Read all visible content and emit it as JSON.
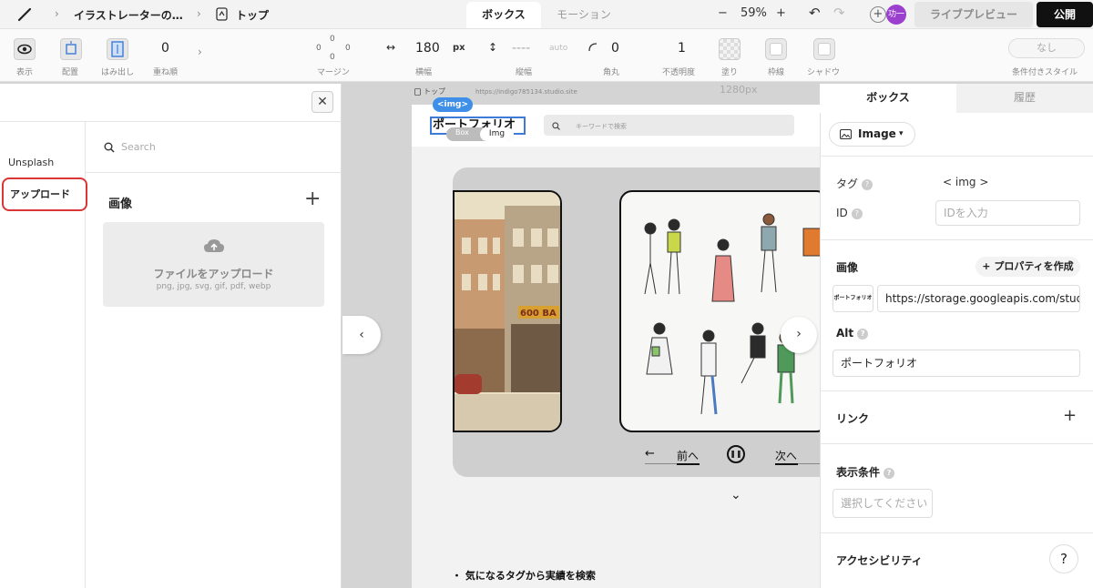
{
  "topbar": {
    "project_name": "イラストレーターの…",
    "page_name": "トップ",
    "tab_box": "ボックス",
    "tab_motion": "モーション",
    "zoom_minus": "−",
    "zoom_level": "59%",
    "zoom_plus": "+",
    "undo": "↶",
    "redo": "↷",
    "add_collaborator": "+",
    "avatar_text": "功一",
    "live_preview": "ライブプレビュー",
    "publish": "公開"
  },
  "toolbar": {
    "display_label": "表示",
    "layout_label": "配置",
    "overflow_label": "はみ出し",
    "zindex_label": "重ね順",
    "zindex_value": "0",
    "margin_label": "マージン",
    "margin_top": "0",
    "margin_left": "0",
    "margin_right": "0",
    "margin_bottom": "0",
    "width_label": "横幅",
    "width_value": "180",
    "width_unit": "px",
    "height_label": "縦幅",
    "height_value": "----",
    "height_unit": "auto",
    "radius_label": "角丸",
    "radius_value": "0",
    "opacity_label": "不透明度",
    "opacity_value": "1",
    "fill_label": "塗り",
    "border_label": "枠線",
    "shadow_label": "シャドウ",
    "conditional_style_label": "条件付きスタイル",
    "conditional_style_value": "なし"
  },
  "left_panel": {
    "source_unsplash": "Unsplash",
    "source_upload": "アップロード",
    "search_placeholder": "Search",
    "images_heading": "画像",
    "add_icon": "+",
    "upload_title": "ファイルをアップロード",
    "upload_formats": "png, jpg, svg, gif, pdf, webp"
  },
  "canvas": {
    "page_label": "トップ",
    "url": "https://indigo785134.studio.site",
    "width_indicator": "1280px",
    "selected_tag": "<img>",
    "crumb_box": "Box",
    "crumb_img": "Img",
    "logo_text": "ポートフォリオ",
    "search_placeholder": "キーワードで検索",
    "prev_label": "前へ",
    "next_label": "次へ",
    "tag_search_text": "・ 気になるタグから実績を検索"
  },
  "right_panel": {
    "tab_box": "ボックス",
    "tab_history": "履歴",
    "element_type": "Image",
    "tag_label": "タグ",
    "tag_value": "< img >",
    "id_label": "ID",
    "id_placeholder": "IDを入力",
    "image_label": "画像",
    "add_property": "+ プロパティを作成",
    "thumb_text": "ポートフォリオ",
    "image_url": "https://storage.googleapis.com/studio-c",
    "alt_label": "Alt",
    "alt_value": "ポートフォリオ",
    "link_label": "リンク",
    "link_add": "+",
    "condition_label": "表示条件",
    "condition_placeholder": "選択してください",
    "accessibility_label": "アクセシビリティ",
    "help_button": "?"
  },
  "colors": {
    "accent_blue": "#3f8fe8",
    "highlight_red": "#d93636",
    "publish_bg": "#111111",
    "avatar_purple": "#9b3fcf"
  }
}
